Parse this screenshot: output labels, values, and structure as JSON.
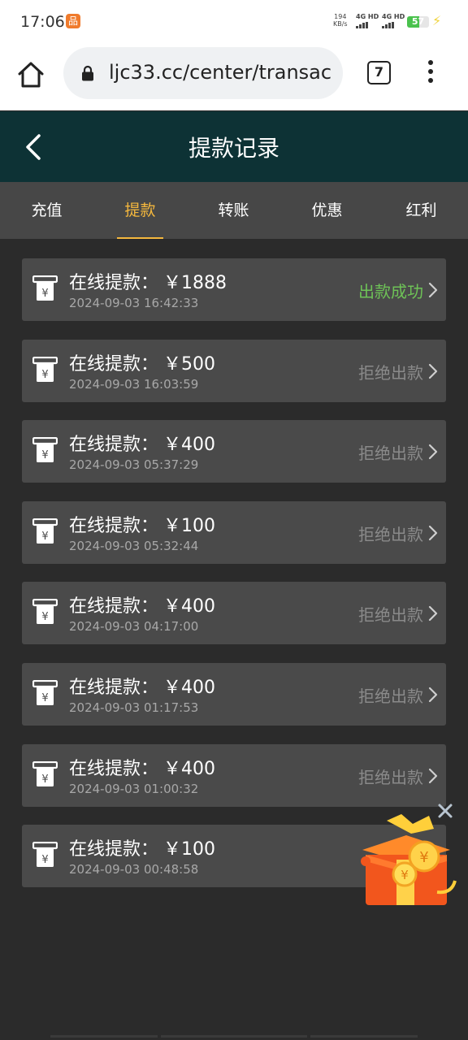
{
  "status_bar": {
    "time": "17:06",
    "app_icon_glyph": "品",
    "net_speed_value": "194",
    "net_speed_unit": "KB/s",
    "sim1": "4G HD",
    "sim2": "4G HD",
    "battery": "57",
    "battery_level": 0.57
  },
  "browser": {
    "url": "ljc33.cc/center/transac",
    "tab_count": "7"
  },
  "header": {
    "title": "提款记录"
  },
  "tabs": [
    {
      "label": "充值",
      "active": false
    },
    {
      "label": "提款",
      "active": true
    },
    {
      "label": "转账",
      "active": false
    },
    {
      "label": "优惠",
      "active": false
    },
    {
      "label": "红利",
      "active": false
    }
  ],
  "records": [
    {
      "title": "在线提款：",
      "amount": "￥1888",
      "time": "2024-09-03 16:42:33",
      "status": "出款成功",
      "success": true
    },
    {
      "title": "在线提款：",
      "amount": "￥500",
      "time": "2024-09-03 16:03:59",
      "status": "拒绝出款",
      "success": false
    },
    {
      "title": "在线提款：",
      "amount": "￥400",
      "time": "2024-09-03 05:37:29",
      "status": "拒绝出款",
      "success": false
    },
    {
      "title": "在线提款：",
      "amount": "￥100",
      "time": "2024-09-03 05:32:44",
      "status": "拒绝出款",
      "success": false
    },
    {
      "title": "在线提款：",
      "amount": "￥400",
      "time": "2024-09-03 04:17:00",
      "status": "拒绝出款",
      "success": false
    },
    {
      "title": "在线提款：",
      "amount": "￥400",
      "time": "2024-09-03 01:17:53",
      "status": "拒绝出款",
      "success": false
    },
    {
      "title": "在线提款：",
      "amount": "￥400",
      "time": "2024-09-03 01:00:32",
      "status": "拒绝出款",
      "success": false
    },
    {
      "title": "在线提款：",
      "amount": "￥100",
      "time": "2024-09-03 00:48:58",
      "status": "拒",
      "success": false
    }
  ],
  "colors": {
    "header_bg": "#0d3235",
    "tab_active": "#f5b83d",
    "status_success": "#6ec257",
    "status_rejected": "#8a8a8a"
  },
  "icons": {
    "back": "chevron-left-icon",
    "record": "yen-receipt-icon",
    "chevron": "chevron-right-icon",
    "promo": "gift-box-icon",
    "close": "close-icon"
  }
}
